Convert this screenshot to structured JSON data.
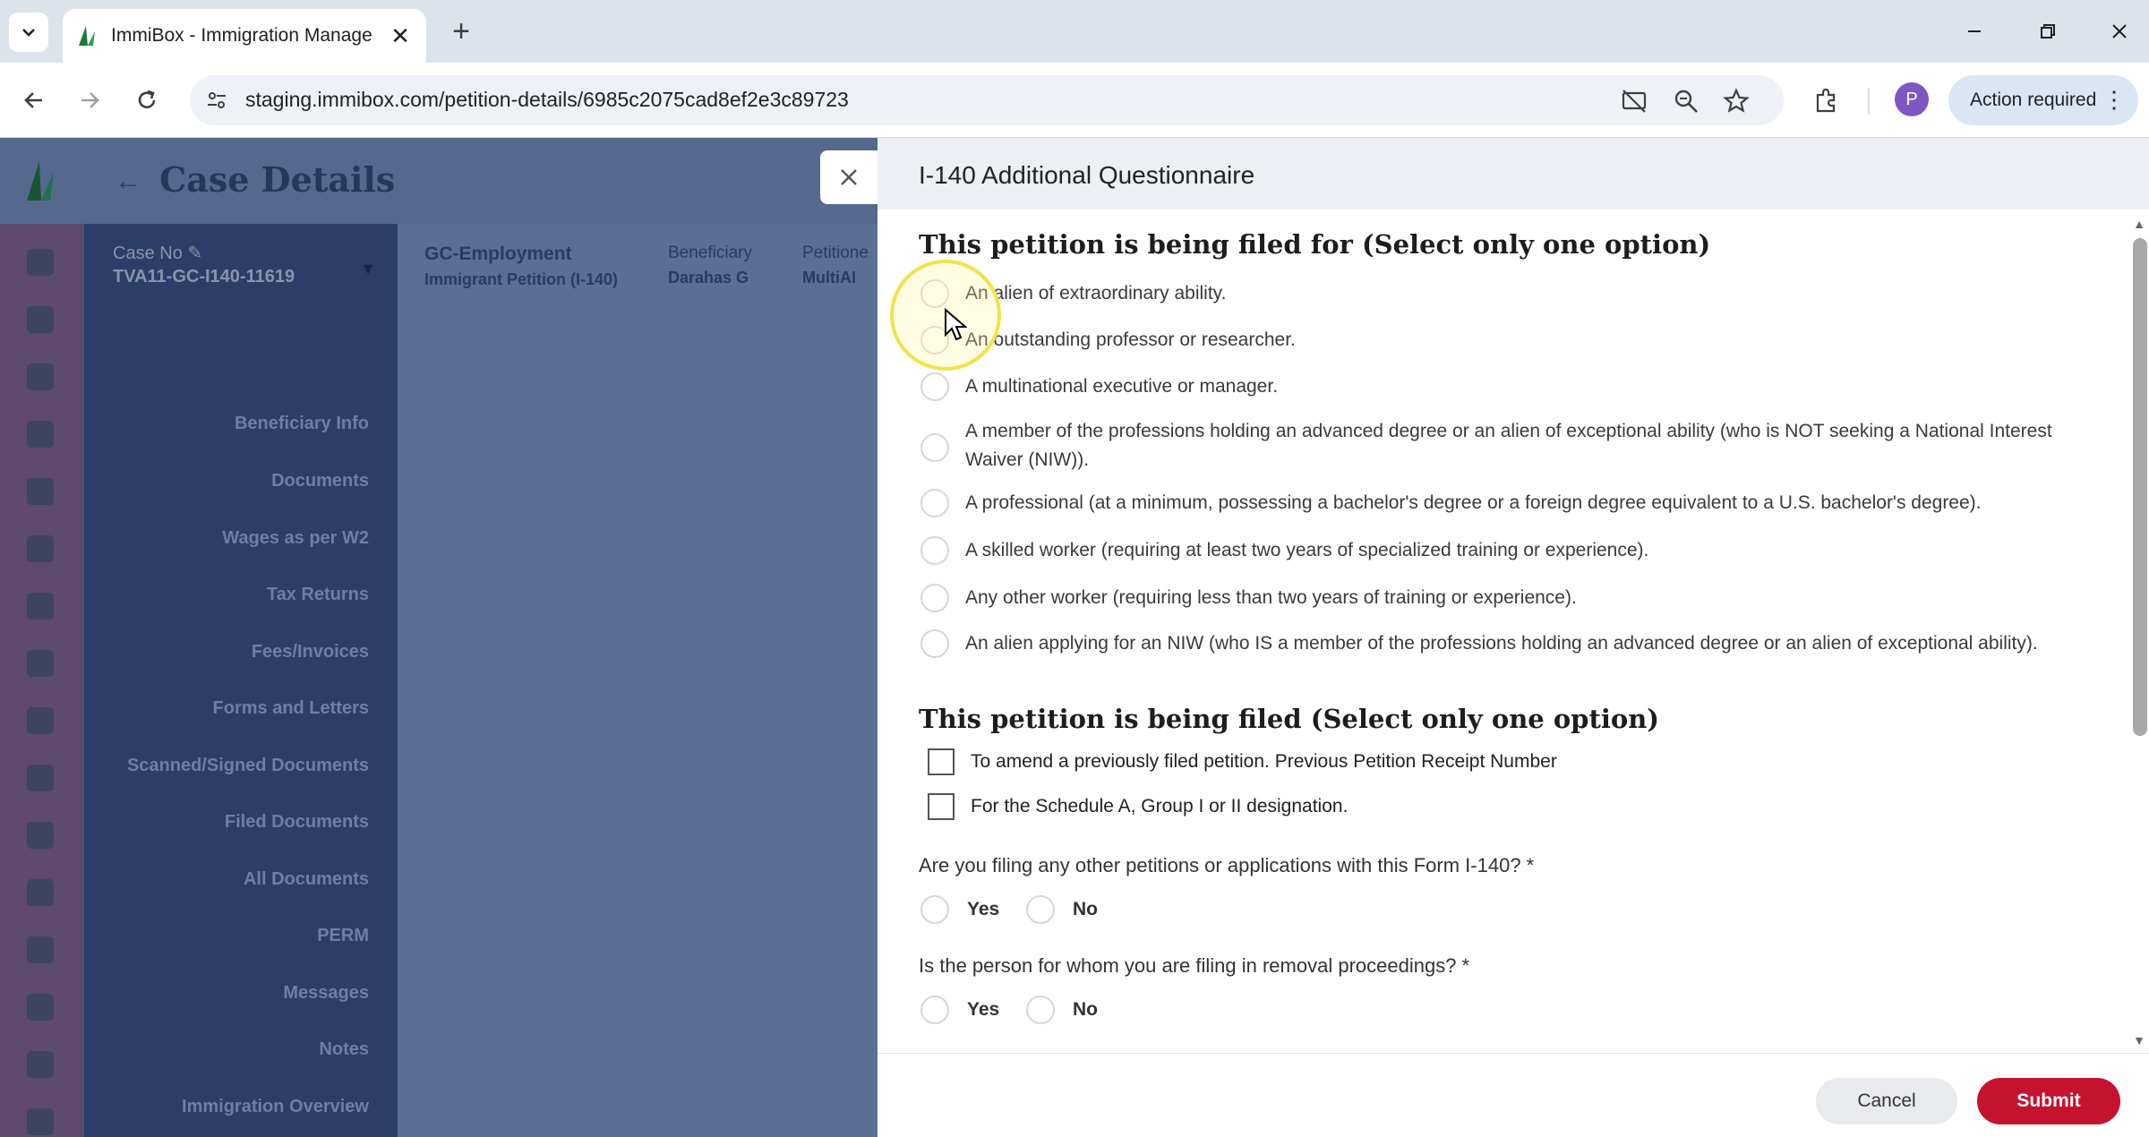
{
  "browser": {
    "tab_title": "ImmiBox - Immigration Manage",
    "url": "staging.immibox.com/petition-details/6985c2075cad8ef2e3c89723",
    "profile_initial": "P",
    "action_required_label": "Action required"
  },
  "app": {
    "page_title": "Case Details",
    "case": {
      "case_no_label": "Case No",
      "case_no": "TVA11-GC-I140-11619",
      "type": "GC-Employment",
      "subtype": "Immigrant Petition (I-140)",
      "beneficiary_label": "Beneficiary",
      "beneficiary": "Darahas G",
      "petitioner_label": "Petitione",
      "petitioner": "MultiAI"
    },
    "sidebar": {
      "items": [
        {
          "label": "Beneficiary Info"
        },
        {
          "label": "Documents"
        },
        {
          "label": "Wages as per W2"
        },
        {
          "label": "Tax Returns"
        },
        {
          "label": "Fees/Invoices"
        },
        {
          "label": "Forms and Letters"
        },
        {
          "label": "Scanned/Signed Documents"
        },
        {
          "label": "Filed Documents"
        },
        {
          "label": "All Documents"
        },
        {
          "label": "PERM"
        },
        {
          "label": "Messages"
        },
        {
          "label": "Notes"
        },
        {
          "label": "Immigration Overview"
        }
      ]
    }
  },
  "questionnaire": {
    "title": "I-140 Additional Questionnaire",
    "section1": {
      "title": "This petition is being filed for (Select only one option)",
      "options": [
        {
          "label": "An alien of extraordinary ability."
        },
        {
          "label": "An outstanding professor or researcher."
        },
        {
          "label": "A multinational executive or manager."
        },
        {
          "label": "A member of the professions holding an advanced degree or an alien of exceptional ability (who is NOT seeking a National Interest Waiver (NIW))."
        },
        {
          "label": "A professional (at a minimum, possessing a bachelor's degree or a foreign degree equivalent to a U.S. bachelor's degree)."
        },
        {
          "label": "A skilled worker (requiring at least two years of specialized training or experience)."
        },
        {
          "label": "Any other worker (requiring less than two years of training or experience)."
        },
        {
          "label": "An alien applying for an NIW (who IS a member of the professions holding an advanced degree or an alien of exceptional ability)."
        }
      ]
    },
    "section2": {
      "title": "This petition is being filed (Select only one option)",
      "options": [
        {
          "label": "To amend a previously filed petition. Previous Petition Receipt Number"
        },
        {
          "label": "For the Schedule A, Group I or II designation."
        }
      ]
    },
    "q1": {
      "text": "Are you filing any other petitions or applications with this Form I-140? *",
      "yes": "Yes",
      "no": "No"
    },
    "q2": {
      "text": "Is the person for whom you are filing in removal proceedings? *",
      "yes": "Yes",
      "no": "No"
    },
    "cancel_label": "Cancel",
    "submit_label": "Submit"
  },
  "colors": {
    "submit": "#c4122f",
    "sidebar_overlay": "#2c3d67",
    "rail": "#5d4a6e"
  }
}
